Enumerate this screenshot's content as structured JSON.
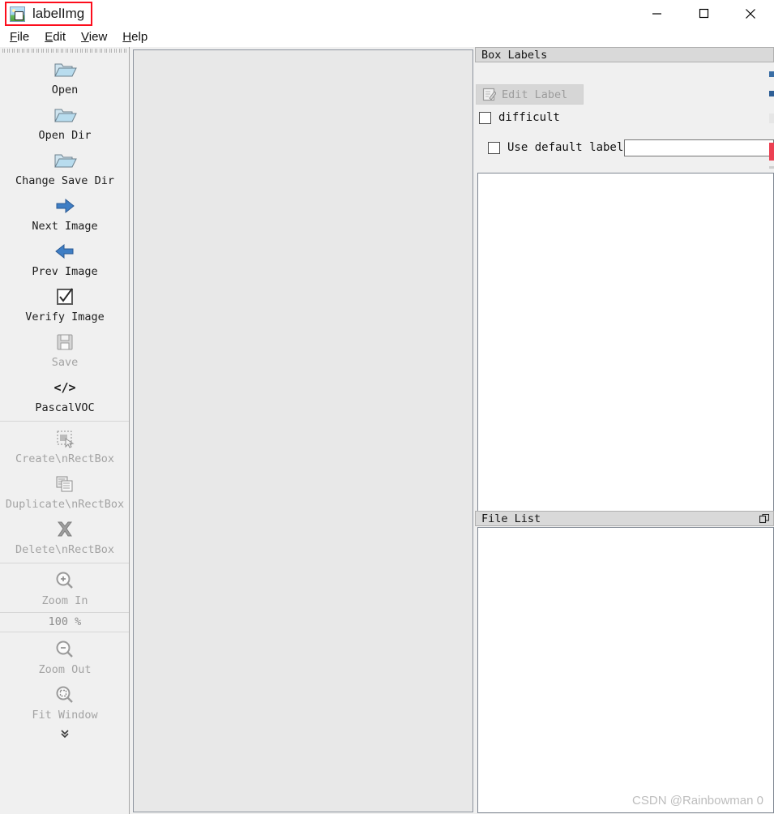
{
  "window": {
    "title": "labelImg",
    "icon": "app-image-icon",
    "highlight_color": "#fc0d1c",
    "controls": [
      {
        "name": "minimize-button",
        "glyph": "minimize-icon"
      },
      {
        "name": "maximize-button",
        "glyph": "maximize-icon"
      },
      {
        "name": "close-button",
        "glyph": "close-icon"
      }
    ]
  },
  "menubar": {
    "items": [
      {
        "label": "File",
        "mnemonic": "F"
      },
      {
        "label": "Edit",
        "mnemonic": "E"
      },
      {
        "label": "View",
        "mnemonic": "V"
      },
      {
        "label": "Help",
        "mnemonic": "H"
      }
    ]
  },
  "toolbar": {
    "items": [
      {
        "label": "Open",
        "icon": "open-folder-icon",
        "enabled": true
      },
      {
        "label": "Open Dir",
        "icon": "open-folder-icon",
        "enabled": true
      },
      {
        "label": "Change Save Dir",
        "icon": "open-folder-icon",
        "enabled": true
      },
      {
        "label": "Next Image",
        "icon": "arrow-right-icon",
        "enabled": true
      },
      {
        "label": "Prev Image",
        "icon": "arrow-left-icon",
        "enabled": true
      },
      {
        "label": "Verify Image",
        "icon": "checkbox-checked-icon",
        "enabled": true
      },
      {
        "label": "Save",
        "icon": "floppy-save-icon",
        "enabled": false
      },
      {
        "label": "PascalVOC",
        "icon": "code-tag-icon",
        "enabled": true
      }
    ],
    "items2": [
      {
        "label": "Create\\nRectBox",
        "icon": "create-rectbox-icon",
        "enabled": false
      },
      {
        "label": "Duplicate\\nRectBox",
        "icon": "duplicate-rectbox-icon",
        "enabled": false
      },
      {
        "label": "Delete\\nRectBox",
        "icon": "delete-x-icon",
        "enabled": false
      }
    ],
    "items3": [
      {
        "label": "Zoom In",
        "icon": "zoom-in-icon",
        "enabled": false
      }
    ],
    "zoom_value": "100 %",
    "items4": [
      {
        "label": "Zoom Out",
        "icon": "zoom-out-icon",
        "enabled": false
      },
      {
        "label": "Fit Window",
        "icon": "fit-window-icon",
        "enabled": false
      }
    ],
    "overflow_glyph": "»"
  },
  "canvas": {
    "content": ""
  },
  "box_labels": {
    "title": "Box Labels",
    "edit_label_button": "Edit Label",
    "edit_label_enabled": false,
    "difficult_label": "difficult",
    "difficult_checked": false,
    "use_default_label": "Use default label",
    "use_default_checked": false,
    "default_label_value": "",
    "default_label_placeholder": "",
    "list_items": []
  },
  "file_list": {
    "title": "File List",
    "float_icon": "undock-icon",
    "items": []
  },
  "watermark": "CSDN @Rainbowman 0"
}
